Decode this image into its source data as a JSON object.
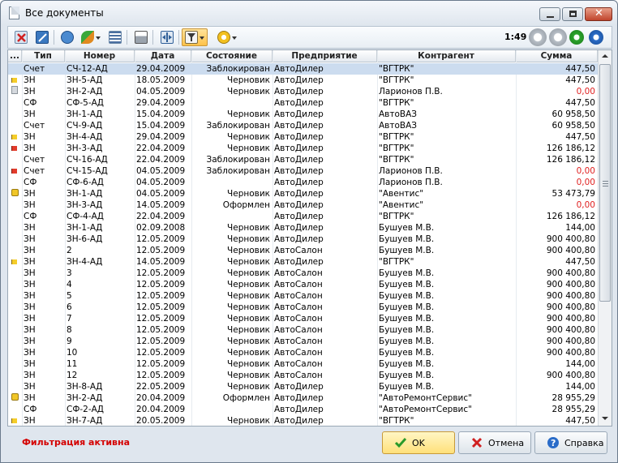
{
  "window": {
    "title": "Все документы",
    "close_glyph": "✕"
  },
  "toolbar": {
    "time": "1:49",
    "buttons": [
      "delete-icon",
      "edit-icon",
      "copy-doc-icon",
      "paint-icon",
      "list-icon",
      "print-icon",
      "split-icon",
      "filter-icon",
      "status-clock-icon"
    ],
    "right_buttons": [
      "gray-circle-icon",
      "gray-circle-icon",
      "green-play-icon",
      "blue-next-icon"
    ]
  },
  "grid": {
    "columns": [
      {
        "key": "mark",
        "label": "..."
      },
      {
        "key": "type",
        "label": "Тип"
      },
      {
        "key": "number",
        "label": "Номер"
      },
      {
        "key": "date",
        "label": "Дата"
      },
      {
        "key": "state",
        "label": "Состояние"
      },
      {
        "key": "company",
        "label": "Предприятие"
      },
      {
        "key": "counterparty",
        "label": "Контрагент"
      },
      {
        "key": "sum",
        "label": "Сумма"
      }
    ],
    "rows": [
      {
        "mark": "",
        "type": "Счет",
        "number": "СЧ-12-АД",
        "date": "29.04.2009",
        "state": "Заблокирован",
        "company": "АвтоДилер",
        "counterparty": "\"ВГТРК\"",
        "sum": "447,50",
        "selected": true
      },
      {
        "mark": "flag-yellow",
        "type": "ЗН",
        "number": "ЗН-5-АД",
        "date": "18.05.2009",
        "state": "Черновик",
        "company": "АвтоДилер",
        "counterparty": "\"ВГТРК\"",
        "sum": "447,50"
      },
      {
        "mark": "note",
        "type": "ЗН",
        "number": "ЗН-2-АД",
        "date": "04.05.2009",
        "state": "Черновик",
        "company": "АвтоДилер",
        "counterparty": "Ларионов П.В.",
        "sum": "0,00",
        "neg": true
      },
      {
        "mark": "",
        "type": "СФ",
        "number": "СФ-5-АД",
        "date": "29.04.2009",
        "state": "",
        "company": "АвтоДилер",
        "counterparty": "\"ВГТРК\"",
        "sum": "447,50"
      },
      {
        "mark": "",
        "type": "ЗН",
        "number": "ЗН-1-АД",
        "date": "15.04.2009",
        "state": "Черновик",
        "company": "АвтоДилер",
        "counterparty": "АвтоВАЗ",
        "sum": "60 958,50"
      },
      {
        "mark": "",
        "type": "Счет",
        "number": "СЧ-9-АД",
        "date": "15.04.2009",
        "state": "Заблокирован",
        "company": "АвтоДилер",
        "counterparty": "АвтоВАЗ",
        "sum": "60 958,50"
      },
      {
        "mark": "flag-yellow",
        "type": "ЗН",
        "number": "ЗН-4-АД",
        "date": "29.04.2009",
        "state": "Черновик",
        "company": "АвтоДилер",
        "counterparty": "\"ВГТРК\"",
        "sum": "447,50"
      },
      {
        "mark": "flag-red",
        "type": "ЗН",
        "number": "ЗН-3-АД",
        "date": "22.04.2009",
        "state": "Черновик",
        "company": "АвтоДилер",
        "counterparty": "\"ВГТРК\"",
        "sum": "126 186,12"
      },
      {
        "mark": "",
        "type": "Счет",
        "number": "СЧ-16-АД",
        "date": "22.04.2009",
        "state": "Заблокирован",
        "company": "АвтоДилер",
        "counterparty": "\"ВГТРК\"",
        "sum": "126 186,12"
      },
      {
        "mark": "flag-red",
        "type": "Счет",
        "number": "СЧ-15-АД",
        "date": "04.05.2009",
        "state": "Заблокирован",
        "company": "АвтоДилер",
        "counterparty": "Ларионов П.В.",
        "sum": "0,00",
        "neg": true
      },
      {
        "mark": "",
        "type": "СФ",
        "number": "СФ-6-АД",
        "date": "04.05.2009",
        "state": "",
        "company": "АвтоДилер",
        "counterparty": "Ларионов П.В.",
        "sum": "0,00",
        "neg": true
      },
      {
        "mark": "lock",
        "type": "ЗН",
        "number": "ЗН-1-АД",
        "date": "04.05.2009",
        "state": "Черновик",
        "company": "АвтоДилер",
        "counterparty": "\"Авентис\"",
        "sum": "53 473,79"
      },
      {
        "mark": "",
        "type": "ЗН",
        "number": "ЗН-3-АД",
        "date": "14.05.2009",
        "state": "Оформлен",
        "company": "АвтоДилер",
        "counterparty": "\"Авентис\"",
        "sum": "0,00",
        "neg": true
      },
      {
        "mark": "",
        "type": "СФ",
        "number": "СФ-4-АД",
        "date": "22.04.2009",
        "state": "",
        "company": "АвтоДилер",
        "counterparty": "\"ВГТРК\"",
        "sum": "126 186,12"
      },
      {
        "mark": "",
        "type": "ЗН",
        "number": "ЗН-1-АД",
        "date": "02.09.2008",
        "state": "Черновик",
        "company": "АвтоДилер",
        "counterparty": "Бушуев М.В.",
        "sum": "144,00"
      },
      {
        "mark": "",
        "type": "ЗН",
        "number": "ЗН-6-АД",
        "date": "12.05.2009",
        "state": "Черновик",
        "company": "АвтоДилер",
        "counterparty": "Бушуев М.В.",
        "sum": "900 400,80"
      },
      {
        "mark": "",
        "type": "ЗН",
        "number": "2",
        "date": "12.05.2009",
        "state": "Черновик",
        "company": "АвтоСалон",
        "counterparty": "Бушуев М.В.",
        "sum": "900 400,80"
      },
      {
        "mark": "flag-yellow",
        "type": "ЗН",
        "number": "ЗН-4-АД",
        "date": "14.05.2009",
        "state": "Черновик",
        "company": "АвтоДилер",
        "counterparty": "\"ВГТРК\"",
        "sum": "447,50"
      },
      {
        "mark": "",
        "type": "ЗН",
        "number": "3",
        "date": "12.05.2009",
        "state": "Черновик",
        "company": "АвтоСалон",
        "counterparty": "Бушуев М.В.",
        "sum": "900 400,80"
      },
      {
        "mark": "",
        "type": "ЗН",
        "number": "4",
        "date": "12.05.2009",
        "state": "Черновик",
        "company": "АвтоСалон",
        "counterparty": "Бушуев М.В.",
        "sum": "900 400,80"
      },
      {
        "mark": "",
        "type": "ЗН",
        "number": "5",
        "date": "12.05.2009",
        "state": "Черновик",
        "company": "АвтоСалон",
        "counterparty": "Бушуев М.В.",
        "sum": "900 400,80"
      },
      {
        "mark": "",
        "type": "ЗН",
        "number": "6",
        "date": "12.05.2009",
        "state": "Черновик",
        "company": "АвтоСалон",
        "counterparty": "Бушуев М.В.",
        "sum": "900 400,80"
      },
      {
        "mark": "",
        "type": "ЗН",
        "number": "7",
        "date": "12.05.2009",
        "state": "Черновик",
        "company": "АвтоСалон",
        "counterparty": "Бушуев М.В.",
        "sum": "900 400,80"
      },
      {
        "mark": "",
        "type": "ЗН",
        "number": "8",
        "date": "12.05.2009",
        "state": "Черновик",
        "company": "АвтоСалон",
        "counterparty": "Бушуев М.В.",
        "sum": "900 400,80"
      },
      {
        "mark": "",
        "type": "ЗН",
        "number": "9",
        "date": "12.05.2009",
        "state": "Черновик",
        "company": "АвтоСалон",
        "counterparty": "Бушуев М.В.",
        "sum": "900 400,80"
      },
      {
        "mark": "",
        "type": "ЗН",
        "number": "10",
        "date": "12.05.2009",
        "state": "Черновик",
        "company": "АвтоСалон",
        "counterparty": "Бушуев М.В.",
        "sum": "900 400,80"
      },
      {
        "mark": "",
        "type": "ЗН",
        "number": "11",
        "date": "12.05.2009",
        "state": "Черновик",
        "company": "АвтоСалон",
        "counterparty": "Бушуев М.В.",
        "sum": "144,00"
      },
      {
        "mark": "",
        "type": "ЗН",
        "number": "12",
        "date": "12.05.2009",
        "state": "Черновик",
        "company": "АвтоСалон",
        "counterparty": "Бушуев М.В.",
        "sum": "900 400,80"
      },
      {
        "mark": "",
        "type": "ЗН",
        "number": "ЗН-8-АД",
        "date": "22.05.2009",
        "state": "Черновик",
        "company": "АвтоДилер",
        "counterparty": "Бушуев М.В.",
        "sum": "144,00"
      },
      {
        "mark": "lock",
        "type": "ЗН",
        "number": "ЗН-2-АД",
        "date": "20.04.2009",
        "state": "Оформлен",
        "company": "АвтоДилер",
        "counterparty": "\"АвтоРемонтСервис\"",
        "sum": "28 955,29"
      },
      {
        "mark": "",
        "type": "СФ",
        "number": "СФ-2-АД",
        "date": "20.04.2009",
        "state": "",
        "company": "АвтоДилер",
        "counterparty": "\"АвтоРемонтСервис\"",
        "sum": "28 955,29"
      },
      {
        "mark": "flag-yellow",
        "type": "ЗН",
        "number": "ЗН-7-АД",
        "date": "20.05.2009",
        "state": "Черновик",
        "company": "АвтоДилер",
        "counterparty": "\"ВГТРК\"",
        "sum": "447,50"
      }
    ]
  },
  "status": {
    "text": "Фильтрация активна"
  },
  "buttons": {
    "ok": "OK",
    "cancel": "Отмена",
    "help": "Справка"
  },
  "colors": {
    "negative": "#e02020",
    "status": "#d40000",
    "selected_row": "#ccdcef"
  }
}
